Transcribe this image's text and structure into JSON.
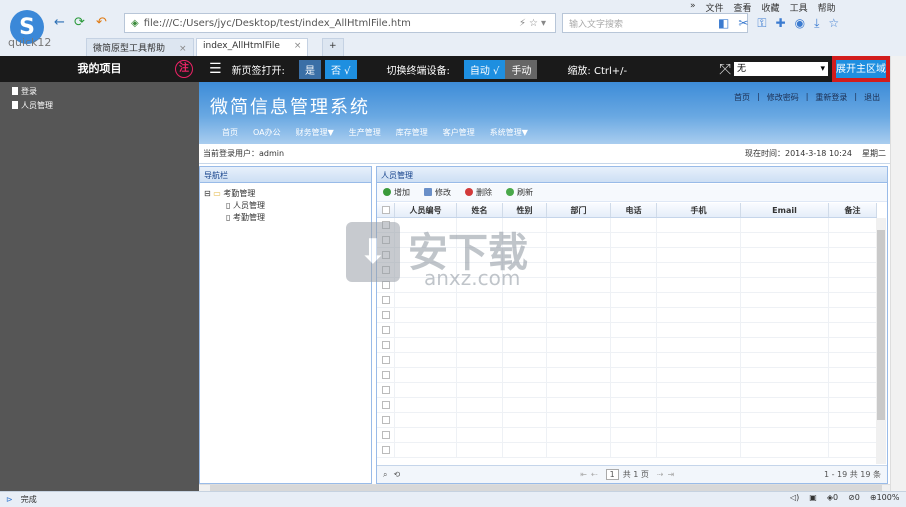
{
  "browser": {
    "quick_label": "quick12",
    "address": "file:///C:/Users/jyc/Desktop/test/index_AllHtmlFile.htm",
    "search_placeholder": "输入文字搜索",
    "menus": [
      "»",
      "文件",
      "查看",
      "收藏",
      "工具",
      "帮助"
    ],
    "tabs": [
      {
        "label": "微简原型工具帮助"
      },
      {
        "label": "index_AllHtmlFile"
      }
    ],
    "new_tab": "+"
  },
  "left": {
    "title": "我的项目",
    "logout": "注",
    "items": [
      "登录",
      "人员管理"
    ]
  },
  "toolbar": {
    "new_tab_label": "新页签打开:",
    "yes": "是",
    "no": "否 √",
    "switch_label": "切换终端设备:",
    "auto": "自动 √",
    "manual": "手动",
    "zoom": "缩放: Ctrl+/-",
    "select_value": "无",
    "expand": "展开主区域"
  },
  "header": {
    "title": "微简信息管理系统",
    "links": [
      "首页",
      "修改密码",
      "重新登录",
      "退出"
    ],
    "nav": [
      "首页",
      "OA办公",
      "财务管理▼",
      "生产管理",
      "库存管理",
      "客户管理",
      "系统管理▼"
    ]
  },
  "userbar": {
    "user": "当前登录用户：admin",
    "time": "现在时间：2014-3-18 10:24",
    "weekday": "星期二"
  },
  "navpanel": {
    "title": "导航栏",
    "folder": "考勤管理",
    "children": [
      "人员管理",
      "考勤管理"
    ]
  },
  "content": {
    "title": "人员管理",
    "actions": [
      "增加",
      "修改",
      "删除",
      "刷新"
    ],
    "columns": [
      "人员编号",
      "姓名",
      "性别",
      "部门",
      "电话",
      "手机",
      "Email",
      "备注"
    ],
    "pager_page": "1",
    "pager_total": "共 1 页",
    "pager_info": "1 - 19  共 19 条"
  },
  "watermark": {
    "text": "安下载",
    "url": "anxz.com"
  },
  "status": {
    "text": "完成",
    "right": [
      "0",
      "0",
      "100%"
    ]
  }
}
